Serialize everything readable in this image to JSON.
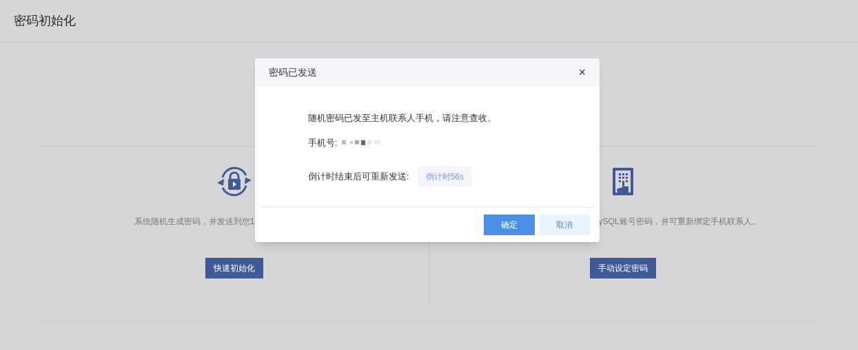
{
  "page": {
    "title": "密码初始化"
  },
  "options": [
    {
      "kind": "quick",
      "description": "系统随机生成密码，并发送到您1",
      "button": "快速初始化"
    },
    {
      "kind": "manual",
      "description": "ySQL账号密码，并可重新绑定手机联系人。",
      "button": "手动设定密码"
    }
  ],
  "dialog": {
    "title": "密码已发送",
    "close": "×",
    "message": "随机密码已发至主机联系人手机，请注意查收。",
    "phone_label": "手机号:",
    "resend_label": "倒计时结束后可重新发送:",
    "countdown": {
      "label": "倒计时56s",
      "disabled": true
    },
    "buttons": [
      {
        "label": "确定",
        "kind": "primary"
      },
      {
        "label": "取消",
        "kind": "secondary"
      }
    ]
  }
}
